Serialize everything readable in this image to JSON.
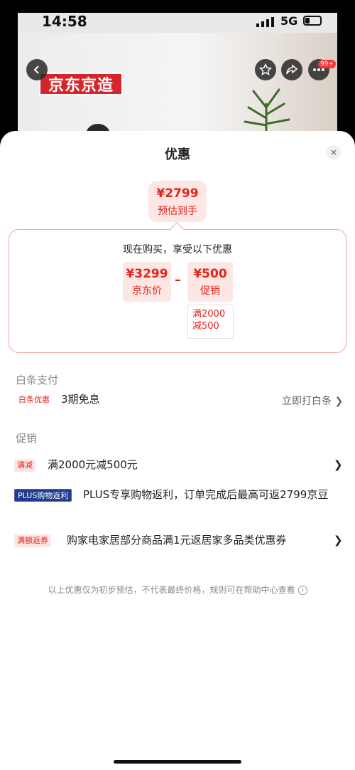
{
  "status_bar": {
    "time": "14:58",
    "network": "5G"
  },
  "product": {
    "brand_logo": "京东京造",
    "badge": "99+"
  },
  "sheet": {
    "title": "优惠",
    "final_price": {
      "amount": "¥2799",
      "label": "预估到手"
    },
    "calc": {
      "title": "现在购买，享受以下优惠",
      "jd_price": {
        "amount": "¥3299",
        "label": "京东价"
      },
      "operator": "–",
      "promo": {
        "amount": "¥500",
        "label": "促销",
        "condition_line1": "满2000",
        "condition_line2": "减500"
      }
    },
    "baitiao": {
      "section_label": "白条支付",
      "tag": "白条优惠",
      "text": "3期免息",
      "link": "立即打白条 ❯"
    },
    "promotions": {
      "section_label": "促销",
      "items": [
        {
          "tag": "满减",
          "text": "满2000元减500元",
          "chevron": "❯"
        },
        {
          "tag": "PLUS购物返利",
          "text": "PLUS专享购物返利，订单完成后最高可返2799京豆"
        },
        {
          "tag": "满额返券",
          "text": "购家电家居部分商品满1元返居家多品类优惠券",
          "chevron": "❯"
        }
      ]
    },
    "footnote": "以上优惠仅为初步预估，不代表最终价格，规则可在帮助中心查看"
  },
  "colors": {
    "accent": "#e1251b",
    "tag_bg": "#fde7e5",
    "plus_blue": "#1f3c8f"
  },
  "icons": [
    "back-icon",
    "star-icon",
    "share-icon",
    "more-icon",
    "close-icon",
    "info-icon",
    "chevron-right-icon"
  ]
}
